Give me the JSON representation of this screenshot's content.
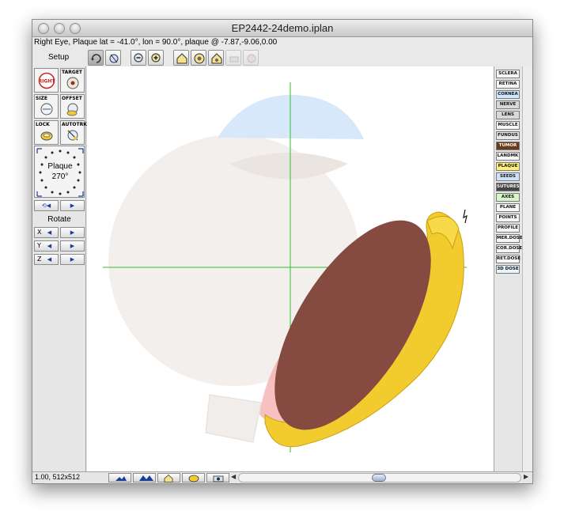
{
  "window": {
    "title": "EP2442-24demo.iplan",
    "status_line": "Right Eye, Plaque lat = -41.0°, lon = 90.0°, plaque @ -7.87,-9.06,0.00"
  },
  "toolbar": {
    "section_label": "Setup",
    "icons": [
      "rotate-view-icon",
      "perspective-icon",
      "zoom-out-icon",
      "zoom-in-icon",
      "home-view-icon",
      "view-a-icon",
      "view-b-icon",
      "view-c-icon",
      "view-d-icon"
    ]
  },
  "left_panel": {
    "buttons": [
      {
        "label": "RIGHT",
        "icon": "right-eye-icon"
      },
      {
        "label": "TARGET",
        "icon": "target-icon"
      },
      {
        "label": "SIZE",
        "icon": "size-icon"
      },
      {
        "label": "OFFSET",
        "icon": "offset-icon"
      },
      {
        "label": "LOCK",
        "icon": "lock-icon"
      },
      {
        "label": "AUTOTRK",
        "icon": "autotrack-icon"
      }
    ],
    "dial": {
      "label": "Plaque",
      "value": "270°"
    },
    "rotate_label": "Rotate",
    "axes": [
      "X",
      "Y",
      "Z"
    ]
  },
  "right_panel": {
    "layers": [
      {
        "label": "SCLERA",
        "color": "#f7f7f7"
      },
      {
        "label": "RETINA",
        "color": "#f7f7f7"
      },
      {
        "label": "CORNEA",
        "color": "#cfe6ff"
      },
      {
        "label": "NERVE",
        "color": "#d9d9d9"
      },
      {
        "label": "LENS",
        "color": "#d9d9d9"
      },
      {
        "label": "MUSCLE",
        "color": "#f7f7f7"
      },
      {
        "label": "FUNDUS",
        "color": "#e6e6e6"
      },
      {
        "label": "TUMOR",
        "color": "#6b3a18"
      },
      {
        "label": "LANDMK",
        "color": "#f7f7f7"
      },
      {
        "label": "PLAQUE",
        "color": "#fff07a"
      },
      {
        "label": "SEEDS",
        "color": "#cfe2f7"
      },
      {
        "label": "SUTURES",
        "color": "#444444"
      },
      {
        "label": "AXES",
        "color": "#d6f5c8"
      },
      {
        "label": "PLANE",
        "color": "#f7f7f7"
      },
      {
        "label": "POINTS",
        "color": "#f7f7f7"
      },
      {
        "label": "PROFILE",
        "color": "#f7f7f7"
      },
      {
        "label": "MER.DOSE",
        "color": "#f7f7f7"
      },
      {
        "label": "COR.DOSE",
        "color": "#f7f7f7"
      },
      {
        "label": "RET.DOSE",
        "color": "#f7f7f7"
      },
      {
        "label": "3D DOSE",
        "color": "#e8f7ff"
      }
    ]
  },
  "bottom_bar": {
    "zoom_text": "1.00, 512x512",
    "icons": [
      "mountain-low-icon",
      "mountain-high-icon",
      "house-icon",
      "plaque-icon",
      "camera-icon"
    ]
  },
  "colors": {
    "sclera": "#f3efec",
    "cornea": "#d8e8fb",
    "tumor": "#854a40",
    "plaque": "#f2cb2e",
    "retina_pink": "#f4a6a6",
    "axis_green": "#2fbf2f"
  }
}
